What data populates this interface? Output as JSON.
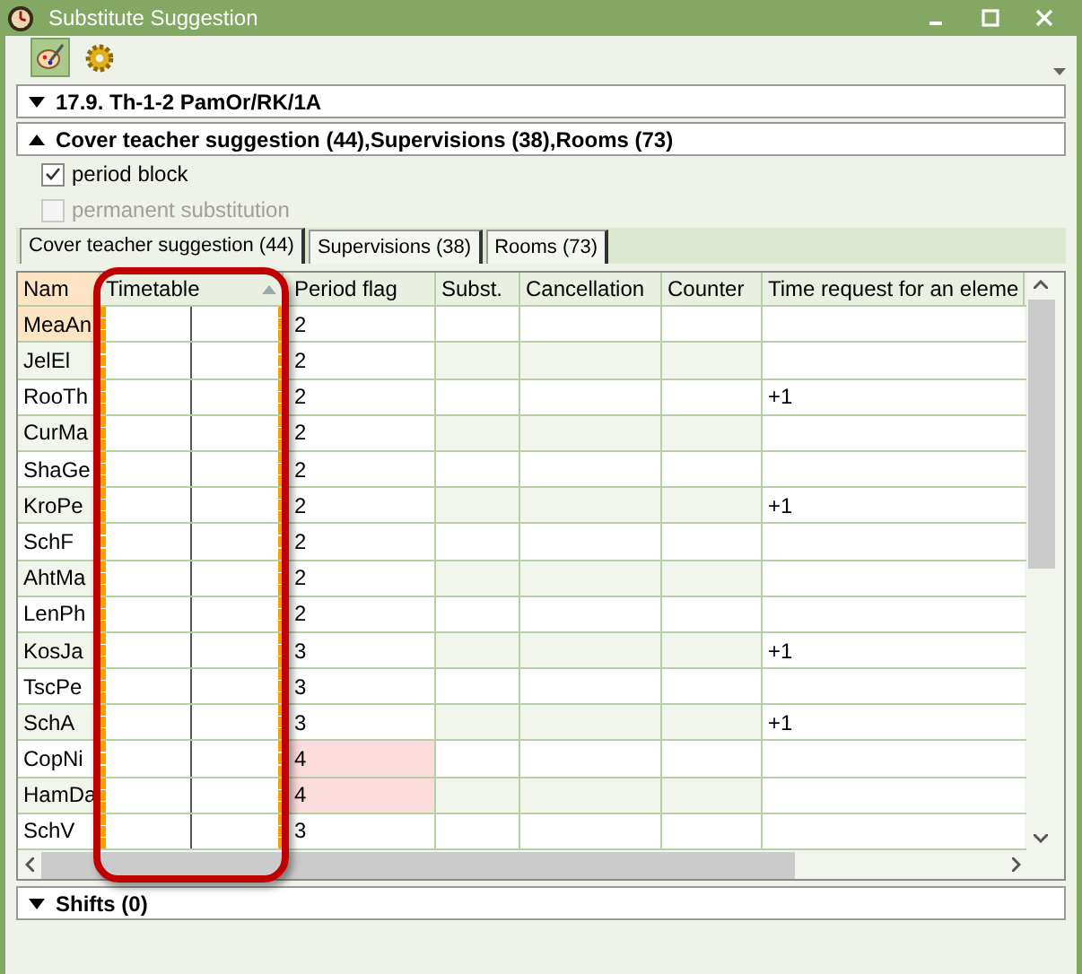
{
  "window": {
    "title": "Substitute Suggestion"
  },
  "sections": [
    {
      "label": "17.9. Th-1-2 PamOr/RK/1A",
      "expanded": false
    },
    {
      "label": "Cover teacher suggestion (44),Supervisions (38),Rooms (73)",
      "expanded": true
    }
  ],
  "options": [
    {
      "label": "period block",
      "checked": true,
      "disabled": false
    },
    {
      "label": "permanent substitution",
      "checked": false,
      "disabled": true
    }
  ],
  "tabs": [
    {
      "label": "Cover teacher suggestion (44)",
      "selected": true
    },
    {
      "label": "Supervisions (38)",
      "selected": false
    },
    {
      "label": "Rooms (73)",
      "selected": false
    }
  ],
  "table": {
    "columns": [
      "Nam",
      "Timetable",
      "Period flag",
      "Subst.",
      "Cancellation",
      "Counter",
      "Time request for an eleme"
    ],
    "rows": [
      {
        "name": "MeaAn",
        "period_flag": "2",
        "selected": true,
        "flagged": false
      },
      {
        "name": "JelEl",
        "period_flag": "2",
        "selected": false,
        "flagged": false
      },
      {
        "name": "RooTh",
        "period_flag": "2",
        "time_request": "+1",
        "selected": false,
        "flagged": false
      },
      {
        "name": "CurMa",
        "period_flag": "2",
        "selected": false,
        "flagged": false
      },
      {
        "name": "ShaGe",
        "period_flag": "2",
        "selected": false,
        "flagged": false
      },
      {
        "name": "KroPe",
        "period_flag": "2",
        "time_request": "+1",
        "selected": false,
        "flagged": false
      },
      {
        "name": "SchF",
        "period_flag": "2",
        "selected": false,
        "flagged": false
      },
      {
        "name": "AhtMa",
        "period_flag": "2",
        "selected": false,
        "flagged": false
      },
      {
        "name": "LenPh",
        "period_flag": "2",
        "selected": false,
        "flagged": false
      },
      {
        "name": "KosJa",
        "period_flag": "3",
        "time_request": "+1",
        "selected": false,
        "flagged": false
      },
      {
        "name": "TscPe",
        "period_flag": "3",
        "selected": false,
        "flagged": false
      },
      {
        "name": "SchA",
        "period_flag": "3",
        "time_request": "+1",
        "selected": false,
        "flagged": false
      },
      {
        "name": "CopNi",
        "period_flag": "4",
        "selected": false,
        "flagged": true
      },
      {
        "name": "HamDa",
        "period_flag": "4",
        "selected": false,
        "flagged": true
      },
      {
        "name": "SchV",
        "period_flag": "3",
        "selected": false,
        "flagged": false
      }
    ]
  },
  "footer_section": {
    "label": "Shifts (0)",
    "expanded": false
  }
}
